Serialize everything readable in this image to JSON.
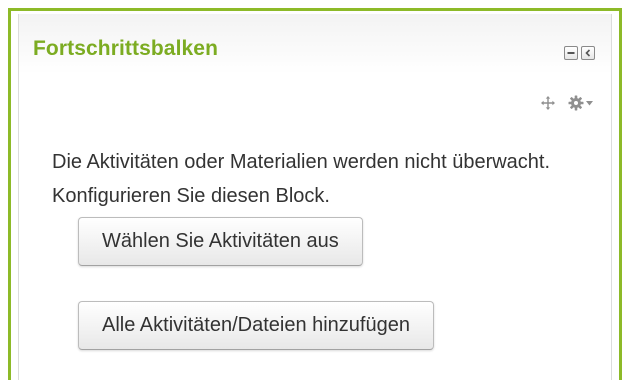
{
  "block": {
    "title": "Fortschrittsbalken",
    "message": "Die Aktivitäten oder Materialien werden nicht überwacht. Konfigurieren Sie diesen Block.",
    "buttons": {
      "choose_activities": "Wählen Sie Aktivitäten aus",
      "add_all": "Alle Aktivitäten/Dateien hinzufügen"
    },
    "header_icons": [
      "minimize-icon",
      "dock-icon"
    ],
    "edit_icons": [
      "move-icon",
      "gear-icon",
      "caret-down-icon"
    ],
    "colors": {
      "accent": "#8dba28",
      "title": "#7cac22",
      "text": "#333333"
    }
  }
}
